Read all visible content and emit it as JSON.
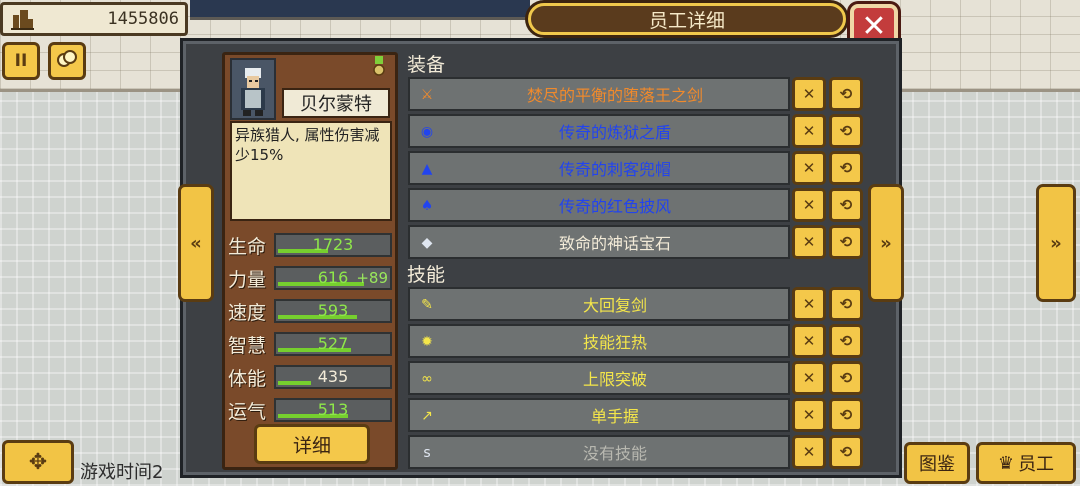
{
  "topbar": {
    "money": "1455806",
    "money_icon": "building-icon",
    "pause_label": "II",
    "coins_icon": "coins-icon"
  },
  "dialog": {
    "title": "员工详细",
    "close_label": "✕"
  },
  "employee": {
    "name": "贝尔蒙特",
    "description": "异族猎人, 属性伤害减少15%",
    "stats": [
      {
        "label": "生命",
        "value": "1723",
        "bonus": "",
        "color": "#8fe84a",
        "fill": 0.45
      },
      {
        "label": "力量",
        "value": "616",
        "bonus": "+89",
        "color": "#8fe84a",
        "fill": 0.78
      },
      {
        "label": "速度",
        "value": "593",
        "bonus": "",
        "color": "#8fe84a",
        "fill": 0.72
      },
      {
        "label": "智慧",
        "value": "527",
        "bonus": "",
        "color": "#8fe84a",
        "fill": 0.66
      },
      {
        "label": "体能",
        "value": "435",
        "bonus": "",
        "color": "#f3ebd8",
        "fill": 0.3
      },
      {
        "label": "运气",
        "value": "513",
        "bonus": "",
        "color": "#8fe84a",
        "fill": 0.64
      }
    ],
    "detail_button": "详细"
  },
  "equipment": {
    "heading": "装备",
    "items": [
      {
        "name": "焚尽的平衡的堕落王之剑",
        "color": "#f08a2c",
        "icon": "sword-icon",
        "glyph": "⚔"
      },
      {
        "name": "传奇的炼狱之盾",
        "color": "#2244ee",
        "icon": "shield-icon",
        "glyph": "◉"
      },
      {
        "name": "传奇的刺客兜帽",
        "color": "#2244ee",
        "icon": "hood-icon",
        "glyph": "▲"
      },
      {
        "name": "传奇的红色披风",
        "color": "#2244ee",
        "icon": "cape-icon",
        "glyph": "♠"
      },
      {
        "name": "致命的神话宝石",
        "color": "#f3ebd8",
        "icon": "gem-icon",
        "glyph": "◆"
      }
    ]
  },
  "skills": {
    "heading": "技能",
    "items": [
      {
        "name": "大回复剑",
        "color": "#f4e64a",
        "icon": "feather-blade-icon",
        "glyph": "✎"
      },
      {
        "name": "技能狂热",
        "color": "#f4e64a",
        "icon": "burst-icon",
        "glyph": "✹"
      },
      {
        "name": "上限突破",
        "color": "#f4e64a",
        "icon": "chain-icon",
        "glyph": "∞"
      },
      {
        "name": "单手握",
        "color": "#f4e64a",
        "icon": "blade-icon",
        "glyph": "↗"
      },
      {
        "name": "没有技能",
        "color": "#b8b8b0",
        "icon": "empty-slot-icon",
        "glyph": "s"
      }
    ]
  },
  "row_buttons": {
    "remove_label": "✕",
    "swap_label": "⟲"
  },
  "nav": {
    "prev_label": "«",
    "next_label": "»",
    "far_next_label": "»",
    "game_time": "游戏时间2",
    "codex": "图鉴",
    "staff": "员工"
  }
}
